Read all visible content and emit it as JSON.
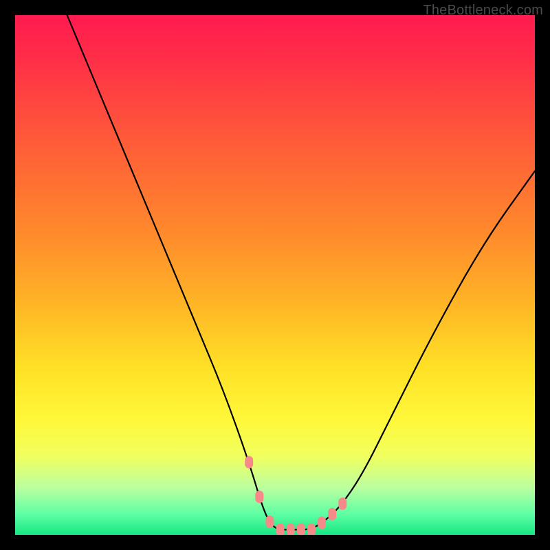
{
  "watermark": "TheBottleneck.com",
  "chart_data": {
    "type": "line",
    "title": "",
    "xlabel": "",
    "ylabel": "",
    "xlim": [
      0,
      100
    ],
    "ylim": [
      0,
      100
    ],
    "grid": false,
    "series": [
      {
        "name": "curve",
        "x": [
          10,
          15,
          20,
          25,
          30,
          35,
          40,
          45,
          48,
          50,
          53,
          57,
          60,
          63,
          67,
          72,
          80,
          90,
          100
        ],
        "y": [
          100,
          88,
          76,
          64,
          52,
          40,
          28,
          14,
          4,
          1,
          1,
          1,
          3,
          6,
          12,
          22,
          38,
          56,
          70
        ]
      }
    ],
    "annotations": [
      {
        "type": "marker_cluster",
        "x_range": [
          45,
          63
        ],
        "y_range": [
          0,
          7
        ],
        "color": "#f58a88"
      }
    ],
    "background_gradient": {
      "orientation": "vertical",
      "stops": [
        {
          "pos": 0.0,
          "color": "#ff1b4f"
        },
        {
          "pos": 0.3,
          "color": "#ff6a34"
        },
        {
          "pos": 0.55,
          "color": "#ffb326"
        },
        {
          "pos": 0.78,
          "color": "#fff83a"
        },
        {
          "pos": 1.0,
          "color": "#17e783"
        }
      ]
    }
  }
}
